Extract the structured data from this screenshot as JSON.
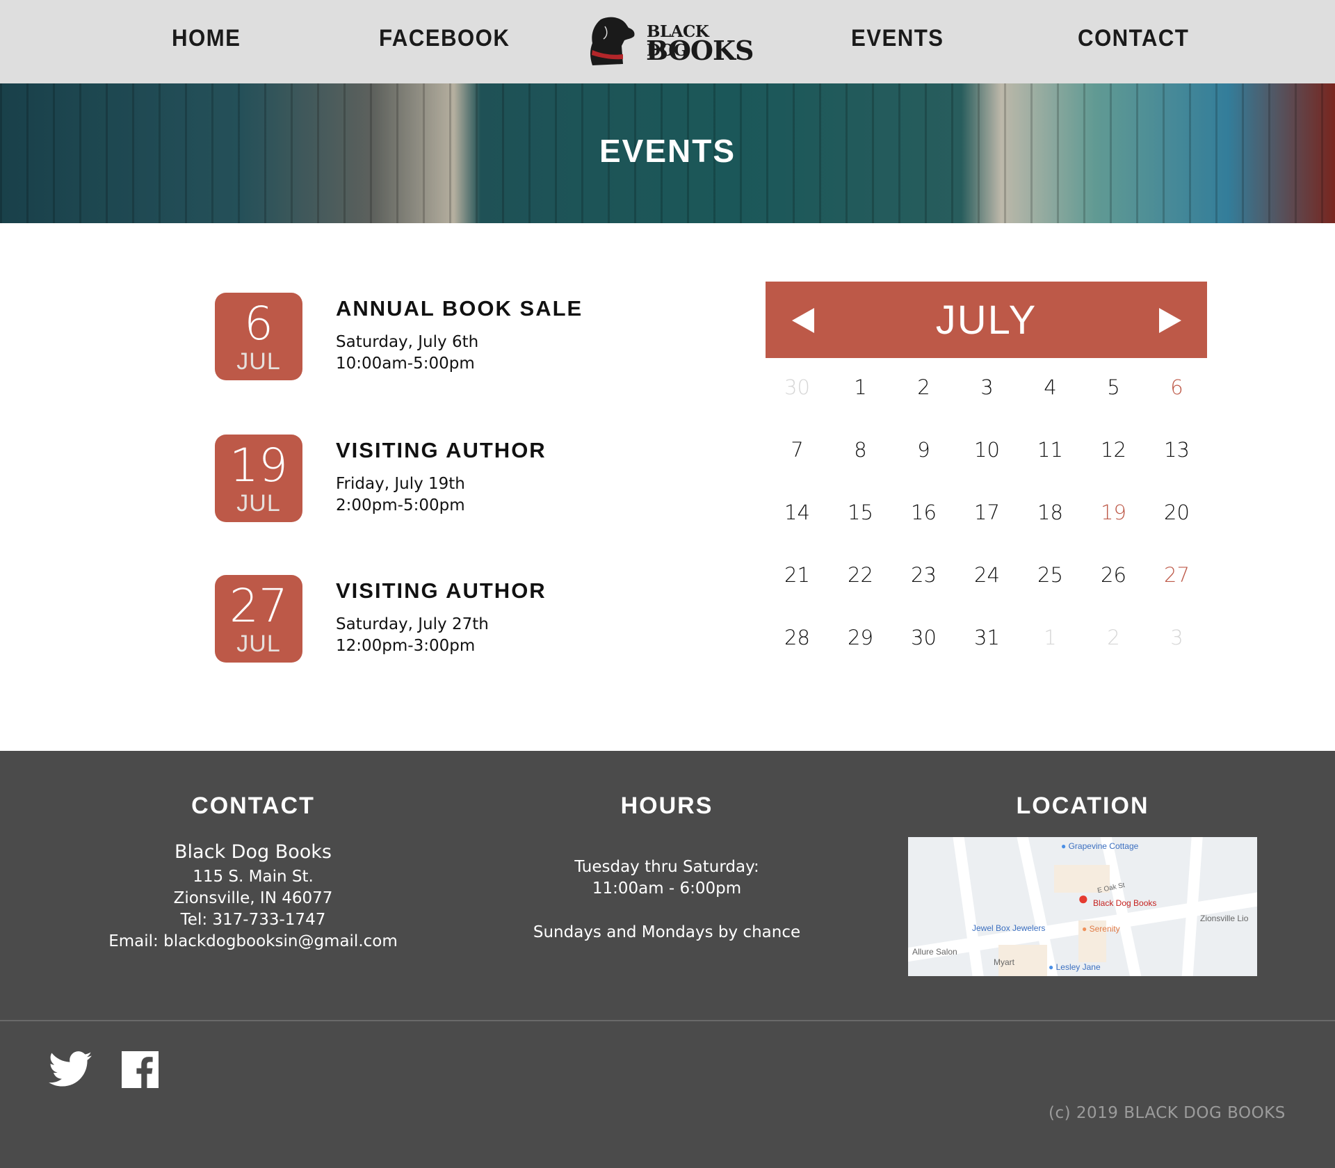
{
  "nav": {
    "items": [
      "HOME",
      "FACEBOOK",
      "EVENTS",
      "CONTACT"
    ],
    "logo_line1": "BLACK DOG",
    "logo_line2": "BOOKS"
  },
  "hero": {
    "title": "EVENTS"
  },
  "events": [
    {
      "day": "6",
      "month": "JUL",
      "title": "ANNUAL BOOK SALE",
      "date": "Saturday, July 6th",
      "time": "10:00am-5:00pm"
    },
    {
      "day": "19",
      "month": "JUL",
      "title": "VISITING AUTHOR",
      "date": "Friday, July 19th",
      "time": "2:00pm-5:00pm"
    },
    {
      "day": "27",
      "month": "JUL",
      "title": "VISITING AUTHOR",
      "date": "Saturday, July 27th",
      "time": "12:00pm-3:00pm"
    }
  ],
  "calendar": {
    "month": "JULY",
    "accent": "#bd5948",
    "weeks": [
      [
        {
          "n": "30",
          "s": "muted"
        },
        {
          "n": "1"
        },
        {
          "n": "2"
        },
        {
          "n": "3"
        },
        {
          "n": "4"
        },
        {
          "n": "5"
        },
        {
          "n": "6",
          "s": "ev"
        }
      ],
      [
        {
          "n": "7"
        },
        {
          "n": "8"
        },
        {
          "n": "9"
        },
        {
          "n": "10"
        },
        {
          "n": "11"
        },
        {
          "n": "12"
        },
        {
          "n": "13"
        }
      ],
      [
        {
          "n": "14"
        },
        {
          "n": "15"
        },
        {
          "n": "16"
        },
        {
          "n": "17"
        },
        {
          "n": "18"
        },
        {
          "n": "19",
          "s": "ev"
        },
        {
          "n": "20"
        }
      ],
      [
        {
          "n": "21"
        },
        {
          "n": "22"
        },
        {
          "n": "23"
        },
        {
          "n": "24"
        },
        {
          "n": "25"
        },
        {
          "n": "26"
        },
        {
          "n": "27",
          "s": "ev"
        }
      ],
      [
        {
          "n": "28"
        },
        {
          "n": "29"
        },
        {
          "n": "30"
        },
        {
          "n": "31"
        },
        {
          "n": "1",
          "s": "muted"
        },
        {
          "n": "2",
          "s": "muted"
        },
        {
          "n": "3",
          "s": "muted"
        }
      ]
    ]
  },
  "footer": {
    "contact": {
      "heading": "CONTACT",
      "name": "Black Dog Books",
      "street": "115 S. Main St.",
      "city": "Zionsville, IN 46077",
      "tel": "Tel: 317-733-1747",
      "email": "Email: blackdogbooksin@gmail.com"
    },
    "hours": {
      "heading": "HOURS",
      "line1": "Tuesday thru Saturday:",
      "line2": "11:00am - 6:00pm",
      "line3": "Sundays and Mondays by chance"
    },
    "location": {
      "heading": "LOCATION",
      "map_labels": {
        "grapevine": "Grapevine Cottage",
        "street": "E Oak St",
        "store": "Black Dog Books",
        "jewel": "Jewel Box Jewelers",
        "serenity": "Serenity",
        "zionsville": "Zionsville Lio",
        "allure": "Allure Salon",
        "myart": "Myart",
        "lesley": "Lesley Jane"
      }
    },
    "copyright": "(c) 2019 BLACK DOG BOOKS"
  }
}
